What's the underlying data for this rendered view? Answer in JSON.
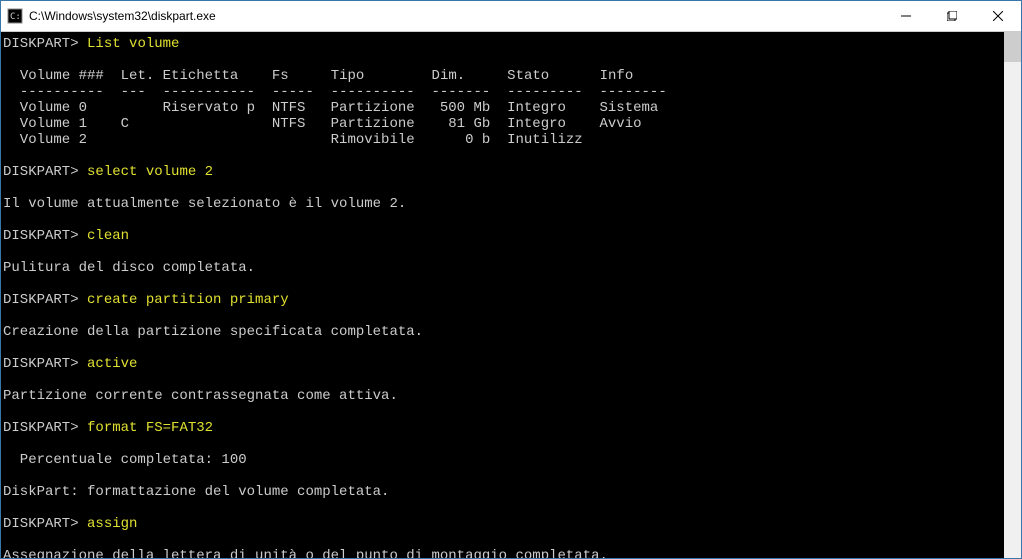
{
  "window": {
    "title": "C:\\Windows\\system32\\diskpart.exe"
  },
  "session": {
    "prompt": "DISKPART>",
    "commands": {
      "list_volume": "List volume",
      "select_volume": "select volume 2",
      "clean": "clean",
      "create_partition": "create partition primary",
      "active": "active",
      "format": "format FS=FAT32",
      "assign": "assign"
    },
    "table": {
      "headers": {
        "volume_num": "Volume ###",
        "letter": "Let.",
        "label": "Etichetta",
        "fs": "Fs",
        "type": "Tipo",
        "size": "Dim.",
        "status": "Stato",
        "info": "Info"
      },
      "sep": "----------  ---  -----------  -----  ----------  -------  ---------  --------",
      "rows": [
        {
          "num": "Volume 0",
          "let": "",
          "label": "Riservato p",
          "fs": "NTFS",
          "type": "Partizione",
          "size": "500 Mb",
          "status": "Integro",
          "info": "Sistema"
        },
        {
          "num": "Volume 1",
          "let": "C",
          "label": "",
          "fs": "NTFS",
          "type": "Partizione",
          "size": "81 Gb",
          "status": "Integro",
          "info": "Avvio"
        },
        {
          "num": "Volume 2",
          "let": "",
          "label": "",
          "fs": "",
          "type": "Rimovibile",
          "size": "0 b",
          "status": "Inutilizz",
          "info": ""
        }
      ]
    },
    "messages": {
      "selected": "Il volume attualmente selezionato è il volume 2.",
      "clean_done": "Pulitura del disco completata.",
      "partition_done": "Creazione della partizione specificata completata.",
      "active_done": "Partizione corrente contrassegnata come attiva.",
      "percent": "  Percentuale completata: 100",
      "format_done": "DiskPart: formattazione del volume completata.",
      "assign_done": "Assegnazione della lettera di unità o del punto di montaggio completata."
    }
  }
}
